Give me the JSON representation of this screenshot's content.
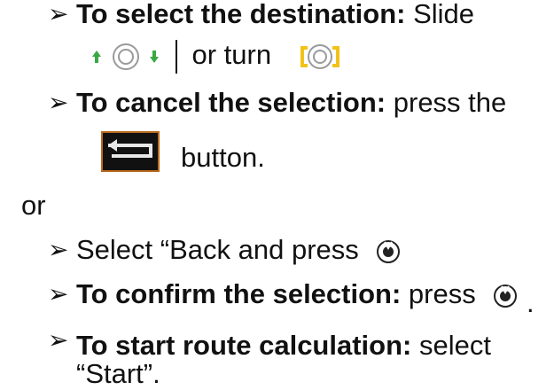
{
  "instructions": {
    "item1": {
      "bullet": "➢",
      "bold": "To select the destination:",
      "rest": " Slide",
      "line2_text": "or turn"
    },
    "item2": {
      "bullet": "➢",
      "bold": "To cancel the selection:",
      "rest": " press the",
      "line2_text": "button."
    },
    "or_text": "or",
    "item3": {
      "bullet": "➢",
      "text": "Select “Back and press"
    },
    "item4": {
      "bullet": "➢",
      "bold": "To confirm the selection:",
      "rest": " press",
      "trailing": "."
    },
    "item5": {
      "bullet": "➢",
      "bold": "To start route calculation:",
      "rest": " select",
      "line2_text": "“Start”."
    }
  },
  "icons": {
    "slide_up_arrow": "arrow-up-icon",
    "slide_knob": "rotary-knob-icon",
    "slide_down_arrow": "arrow-down-icon",
    "turn_knob": "rotate-knob-icon",
    "back_button": "back-button-icon",
    "press_knob": "press-knob-icon"
  },
  "colors": {
    "text": "#111111",
    "green_arrow": "#39a845",
    "yellow_arrow": "#f3c21a",
    "back_border": "#b96a1c"
  }
}
